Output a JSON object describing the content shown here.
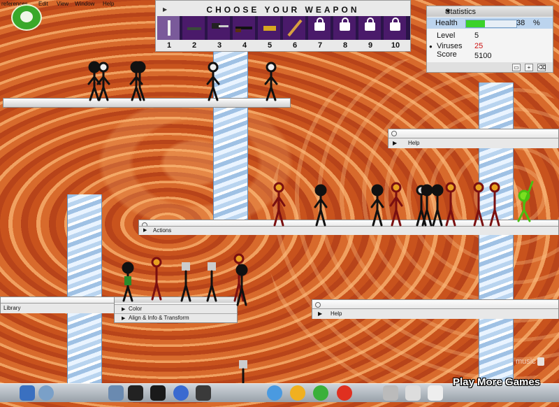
{
  "menu": {
    "items": [
      "references",
      "Edit",
      "View",
      "Window",
      "Help"
    ]
  },
  "weapons": {
    "title": "CHOOSE YOUR WEAPON",
    "selected": 1,
    "slots": [
      {
        "num": "1",
        "icon": "sword-icon",
        "locked": false
      },
      {
        "num": "2",
        "icon": "bat-icon",
        "locked": false
      },
      {
        "num": "3",
        "icon": "hammer-icon",
        "locked": false
      },
      {
        "num": "4",
        "icon": "shotgun-icon",
        "locked": false
      },
      {
        "num": "5",
        "icon": "bomb-icon",
        "locked": false
      },
      {
        "num": "6",
        "icon": "baseball-bat-icon",
        "locked": false
      },
      {
        "num": "7",
        "icon": "lock-icon",
        "locked": true
      },
      {
        "num": "8",
        "icon": "lock-icon",
        "locked": true
      },
      {
        "num": "9",
        "icon": "lock-icon",
        "locked": true
      },
      {
        "num": "10",
        "icon": "lock-icon",
        "locked": true
      }
    ]
  },
  "stats": {
    "title": "Statistics",
    "health_label": "Health",
    "health_value": "38",
    "health_unit": "%",
    "health_fraction": 0.38,
    "level_label": "Level",
    "level_value": "5",
    "viruses_label": "Viruses",
    "viruses_value": "25",
    "score_label": "Score",
    "score_value": "5100",
    "colors": {
      "health_fill": "#3ad22a",
      "viruses_value": "#cc1111"
    }
  },
  "panels": {
    "help_top": "Help",
    "actions": "Actions",
    "library": "Library",
    "color": "Color",
    "align": "Align & Info & Transform",
    "help_bottom": "Help"
  },
  "footer": {
    "play_more": "Play More Games",
    "music": "music"
  }
}
